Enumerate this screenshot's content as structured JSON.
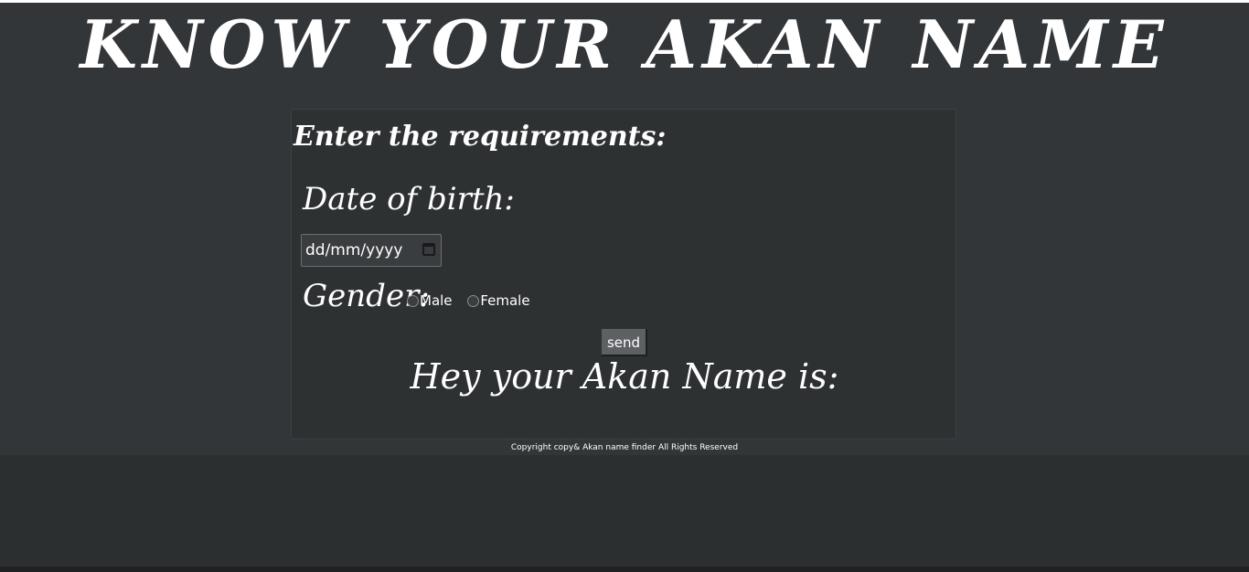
{
  "header": {
    "title": "KNOW YOUR AKAN NAME"
  },
  "form": {
    "title": "Enter the requirements:",
    "dob_label": "Date of birth:",
    "date_placeholder": "dd/mm/yyyy",
    "gender_label": "Gender:",
    "gender_options": [
      {
        "label": "Male",
        "selected": false
      },
      {
        "label": "Female",
        "selected": false
      }
    ],
    "send_label": "send",
    "result_text": "Hey your Akan Name is:"
  },
  "footer": {
    "text": "Copyright copy& Akan name finder All Rights Reserved"
  },
  "colors": {
    "background": "#333638",
    "card_background": "#2e3132",
    "text": "#ffffff",
    "button": "#5e6163"
  },
  "icons": {
    "date_picker": "calendar-icon"
  }
}
